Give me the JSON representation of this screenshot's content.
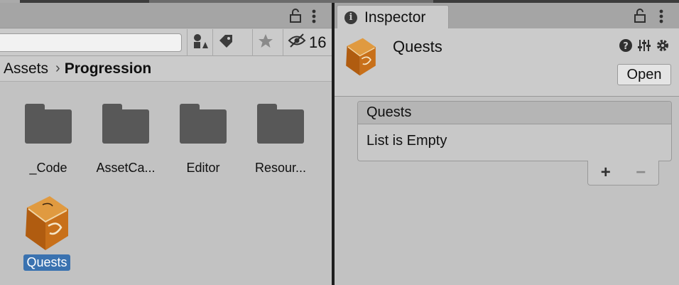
{
  "project": {
    "hidden_count": "16",
    "breadcrumb": {
      "root": "Assets",
      "separator": "›",
      "current": "Progression"
    },
    "assets": [
      {
        "label": "_Code",
        "icon": "folder-icon"
      },
      {
        "label": "AssetCa...",
        "icon": "folder-icon"
      },
      {
        "label": "Editor",
        "icon": "folder-icon"
      },
      {
        "label": "Resour...",
        "icon": "folder-icon"
      },
      {
        "label": "Quests",
        "icon": "scroll-book-icon",
        "selected": true
      }
    ]
  },
  "inspector": {
    "tab_label": "Inspector",
    "title": "Quests",
    "open_label": "Open",
    "list": {
      "header": "Quests",
      "empty_text": "List is Empty",
      "add_label": "+",
      "remove_label": "−"
    }
  },
  "colors": {
    "selection": "#3a72b0",
    "book_orange": "#c8701a",
    "panel": "#c2c2c2",
    "divider": "#1e1e1e"
  }
}
